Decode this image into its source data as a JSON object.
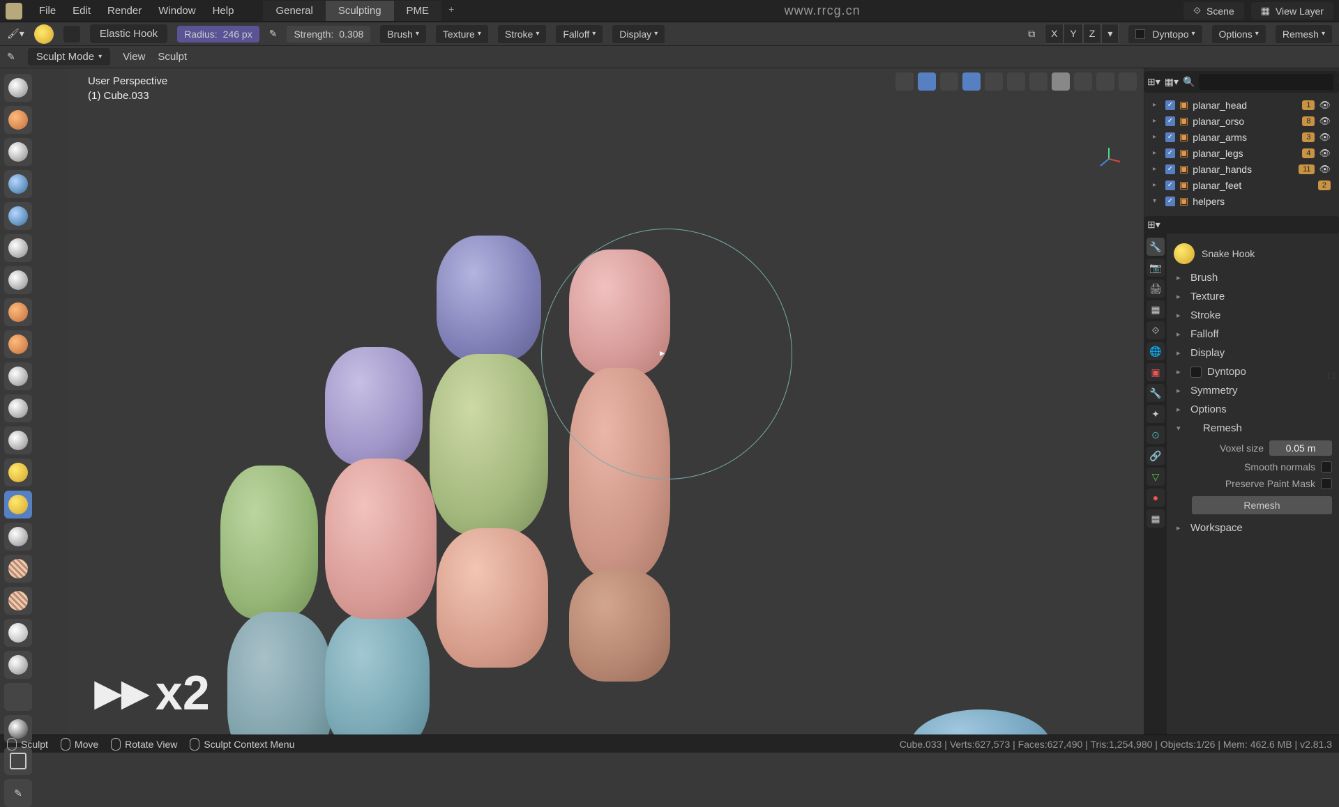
{
  "top_menu": {
    "items": [
      "File",
      "Edit",
      "Render",
      "Window",
      "Help"
    ],
    "tabs": [
      "General",
      "Sculpting",
      "PME"
    ],
    "active_tab": 1,
    "url": "www.rrcg.cn",
    "scene": "Scene",
    "view_layer": "View Layer"
  },
  "tool_header": {
    "brush_name": "Elastic Hook",
    "radius_label": "Radius:",
    "radius_value": "246 px",
    "strength_label": "Strength:",
    "strength_value": "0.308",
    "dropdowns": [
      "Brush",
      "Texture",
      "Stroke",
      "Falloff",
      "Display"
    ],
    "axes": [
      "X",
      "Y",
      "Z"
    ],
    "dyntopo": "Dyntopo",
    "options": "Options",
    "remesh": "Remesh"
  },
  "mode_header": {
    "mode": "Sculpt Mode",
    "menus": [
      "View",
      "Sculpt"
    ]
  },
  "viewport": {
    "perspective": "User Perspective",
    "object": "(1) Cube.033",
    "speed": "x2"
  },
  "outliner": {
    "items": [
      {
        "name": "planar_head",
        "badge": "1"
      },
      {
        "name": "planar_orso",
        "badge": "8"
      },
      {
        "name": "planar_arms",
        "badge": "3"
      },
      {
        "name": "planar_legs",
        "badge": "4"
      },
      {
        "name": "planar_hands",
        "badge": "11"
      },
      {
        "name": "planar_feet",
        "badge": "2"
      },
      {
        "name": "helpers",
        "badge": ""
      }
    ]
  },
  "properties": {
    "brush_name": "Snake Hook",
    "panels": [
      "Brush",
      "Texture",
      "Stroke",
      "Falloff",
      "Display",
      "Dyntopo",
      "Symmetry",
      "Options"
    ],
    "remesh": {
      "title": "Remesh",
      "voxel_label": "Voxel size",
      "voxel_value": "0.05 m",
      "smooth_label": "Smooth normals",
      "preserve_label": "Preserve Paint Mask",
      "button": "Remesh"
    },
    "workspace": "Workspace"
  },
  "status": {
    "sculpt": "Sculpt",
    "move": "Move",
    "rotate": "Rotate View",
    "context": "Sculpt Context Menu",
    "stats": "Cube.033 | Verts:627,573 | Faces:627,490 | Tris:1,254,980 | Objects:1/26 | Mem: 462.6 MB | v2.81.3"
  }
}
